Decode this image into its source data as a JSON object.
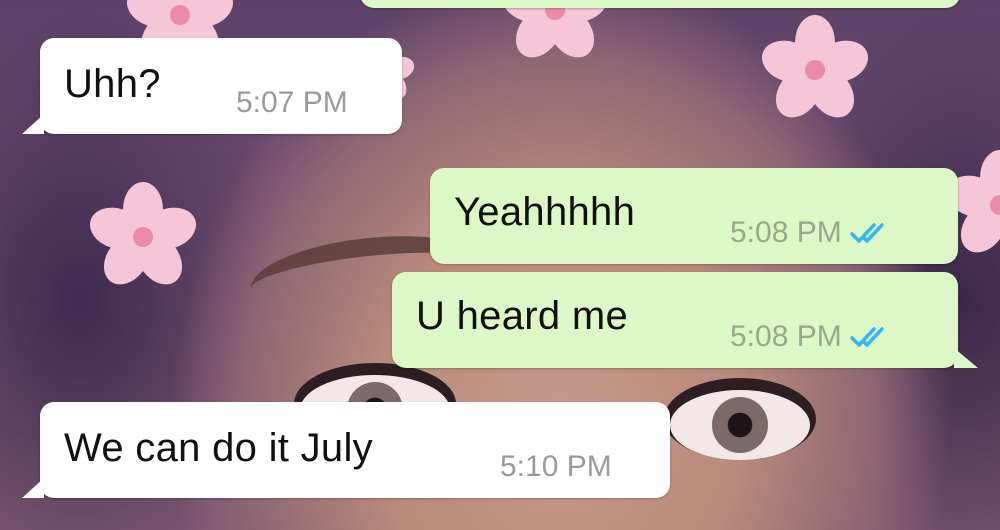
{
  "messages": [
    {
      "direction": "in",
      "text": "Uhh?",
      "time": "5:07 PM"
    },
    {
      "direction": "out",
      "text": "Yeahhhhh",
      "time": "5:08 PM",
      "status": "read"
    },
    {
      "direction": "out",
      "text": "U heard me",
      "time": "5:08 PM",
      "status": "read"
    },
    {
      "direction": "in",
      "text": "We can do it July",
      "time": "5:10 PM"
    }
  ],
  "colors": {
    "incoming_bubble": "#ffffff",
    "outgoing_bubble": "#dcf8c6",
    "read_ticks": "#34b7f1",
    "timestamp": "#9a9a9a"
  },
  "icons": {
    "read_receipt": "double-check-icon"
  }
}
